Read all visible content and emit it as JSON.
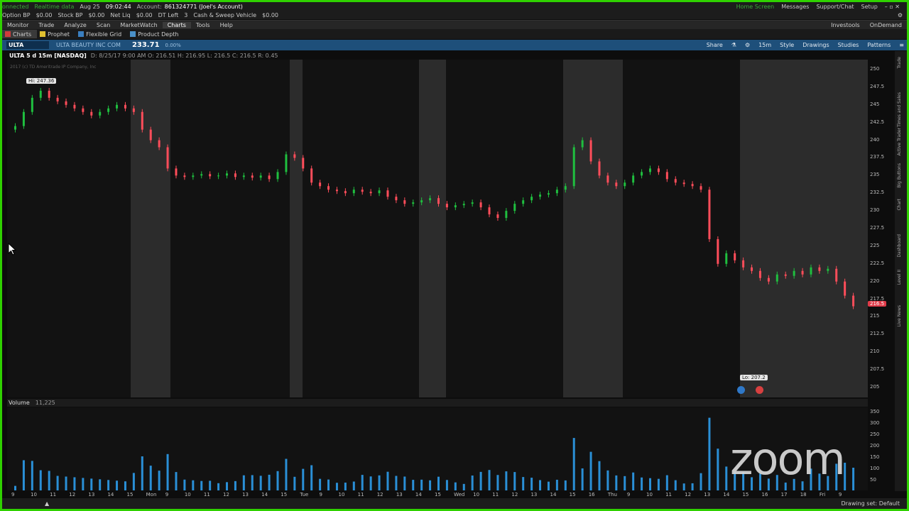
{
  "status": {
    "connection": "onnected",
    "data_type": "Realtime data",
    "date": "Aug 25",
    "time": "09:02:44",
    "account_label": "Account:",
    "account": "861324771 (Joel's Account)",
    "option_bp_label": "Option BP",
    "option_bp": "$0.00",
    "stock_bp_label": "Stock BP",
    "stock_bp": "$0.00",
    "net_liq_label": "Net Liq",
    "net_liq": "$0.00",
    "dt_left_label": "DT Left",
    "dt_left": "3",
    "cash_label": "Cash & Sweep Vehicle",
    "cash": "$0.00",
    "home_screen": "Home Screen",
    "messages": "Messages",
    "support": "Support/Chat",
    "setup": "Setup"
  },
  "menu": {
    "items": [
      "Monitor",
      "Trade",
      "Analyze",
      "Scan",
      "MarketWatch",
      "Charts",
      "Tools",
      "Help"
    ],
    "right_items": [
      "Investools",
      "OnDemand"
    ]
  },
  "subtabs": [
    "Charts",
    "Prophet",
    "Flexible Grid",
    "Product Depth"
  ],
  "toolbar": {
    "symbol": "ULTA",
    "description": "ULTA BEAUTY INC COM",
    "last": "233.71",
    "change": "0.00%",
    "buttons": [
      "Share",
      "15m",
      "Style",
      "Drawings",
      "Studies",
      "Patterns"
    ]
  },
  "chart_info": {
    "title": "ULTA 5 d 15m [NASDAQ]",
    "ohlc": "D: 8/25/17 9:00 AM  O: 216.51  H: 216.95  L: 216.5  C: 216.5  R: 0.45",
    "copyright": "2017 (c) TD Ameritrade IP Company, Inc"
  },
  "annotations": {
    "high": "Hi: 247.36",
    "low": "Lo: 207.2",
    "last_price": "216.5"
  },
  "volume": {
    "label": "Volume",
    "value": "11,225"
  },
  "bottom": {
    "drawing_set": "Drawing set: Default"
  },
  "side_tabs": [
    "Trade",
    "Times and Sales",
    "Active Trader",
    "Big Buttons",
    "Chart",
    "Dashboard",
    "Level II",
    "Live News"
  ],
  "watermark": "zoom",
  "colors": {
    "up": "#1fbf3f",
    "down": "#ff4d5a",
    "session_band": "#2c2c2c",
    "accent": "#2fd100",
    "toolbar": "#1e4f7a"
  },
  "chart_data": {
    "type": "candlestick",
    "title": "ULTA 5 d 15m [NASDAQ]",
    "ylim": [
      205,
      250
    ],
    "y_ticks": [
      250,
      247.5,
      245,
      242.5,
      240,
      237.5,
      235,
      232.5,
      230,
      227.5,
      225,
      222.5,
      220,
      217.5,
      215,
      212.5,
      210,
      207.5,
      205
    ],
    "x_ticks": [
      "9",
      "10",
      "11",
      "12",
      "13",
      "14",
      "15",
      "Mon",
      "9",
      "10",
      "11",
      "12",
      "13",
      "14",
      "15",
      "Tue",
      "9",
      "10",
      "11",
      "12",
      "13",
      "14",
      "15",
      "Wed",
      "10",
      "11",
      "12",
      "13",
      "14",
      "15",
      "16",
      "Thu",
      "9",
      "10",
      "11",
      "12",
      "13",
      "14",
      "15",
      "16",
      "17",
      "18",
      "Fri",
      "9"
    ],
    "close_series": [
      242,
      244,
      246,
      247,
      246,
      245.5,
      245,
      244.5,
      244,
      243.5,
      244,
      244.5,
      245,
      244.5,
      244,
      241.5,
      240,
      239,
      236,
      235,
      234.8,
      235,
      235.2,
      234.9,
      235,
      235.3,
      234.8,
      235,
      234.7,
      235,
      234.5,
      235.5,
      238,
      237.5,
      236,
      234,
      233.5,
      233,
      232.8,
      232.5,
      233,
      232.7,
      232.5,
      232.9,
      232,
      231.5,
      231,
      231.2,
      231.5,
      231.8,
      231,
      230.5,
      230.8,
      231,
      231.2,
      230.5,
      229.5,
      229,
      230,
      231,
      231.5,
      232,
      232.3,
      232.5,
      233,
      233.5,
      239,
      240,
      237,
      235,
      234,
      233.5,
      234,
      235,
      235.5,
      236,
      235.5,
      234.5,
      234,
      233.8,
      233.5,
      233,
      226,
      222.5,
      224,
      223,
      222,
      221.5,
      220.5,
      220,
      221,
      220.8,
      221.5,
      221,
      222,
      221.5,
      221.8,
      220,
      218,
      216.5
    ],
    "volume_ylim": [
      0,
      350
    ],
    "volume_y_ticks": [
      350,
      300,
      250,
      200,
      150,
      100,
      50
    ]
  }
}
